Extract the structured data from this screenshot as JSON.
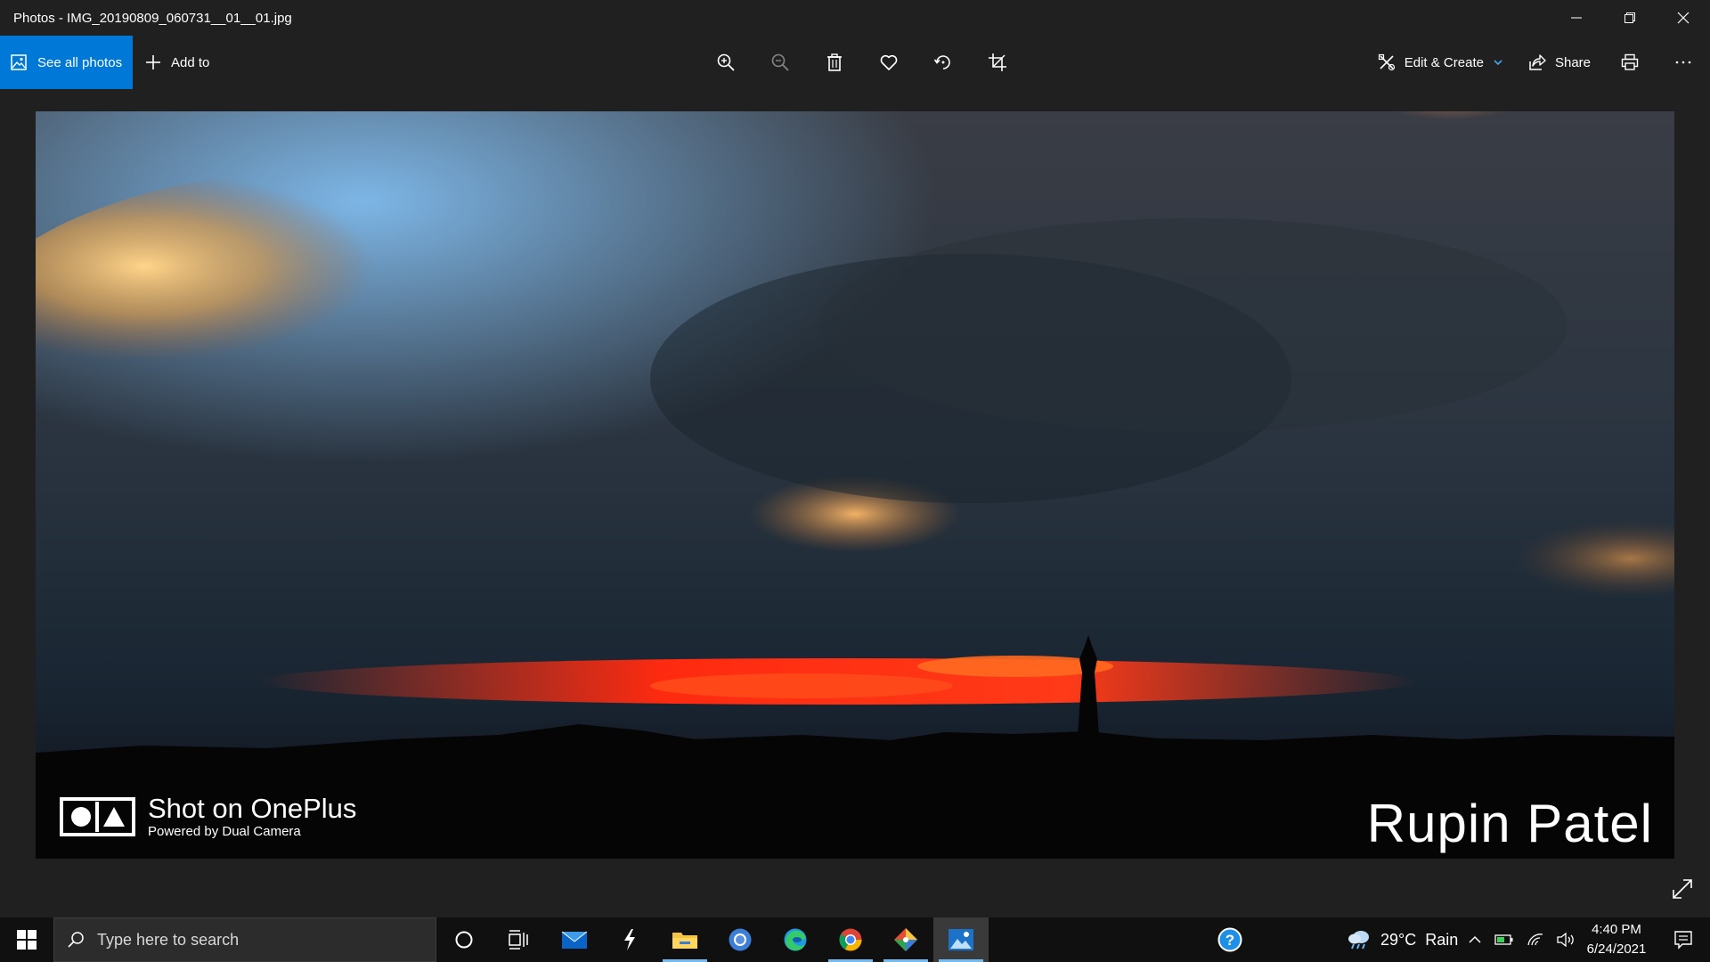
{
  "window": {
    "title": "Photos - IMG_20190809_060731__01__01.jpg",
    "controls": [
      "minimize-icon",
      "restore-icon",
      "close-icon"
    ]
  },
  "toolbar": {
    "see_all_label": "See all photos",
    "add_to_label": "Add to",
    "tools": [
      "zoom-in-icon",
      "zoom-out-icon",
      "delete-icon",
      "favorite-icon",
      "rotate-icon",
      "crop-icon"
    ],
    "edit_create_label": "Edit & Create",
    "share_label": "Share",
    "print_icon": "print-icon",
    "more_icon": "more-icon"
  },
  "photo": {
    "description_icon": "sunset-photo",
    "watermark_title": "Shot on OnePlus",
    "watermark_subtitle": "Powered by Dual Camera",
    "signature": "Rupin Patel"
  },
  "taskbar": {
    "search_placeholder": "Type here to search",
    "apps": [
      "cortana-icon",
      "task-view-icon",
      "mail-icon",
      "thunderbolt-icon",
      "file-explorer-icon",
      "chrome-canary-icon",
      "edge-icon",
      "chrome-icon",
      "git-icon",
      "photos-icon"
    ],
    "help_icon": "help-icon",
    "weather_temp": "29°C",
    "weather_desc": "Rain",
    "time": "4:40 PM",
    "date": "6/24/2021"
  },
  "colors": {
    "accent": "#0078d7",
    "background": "#202020",
    "taskbar": "#101010"
  }
}
